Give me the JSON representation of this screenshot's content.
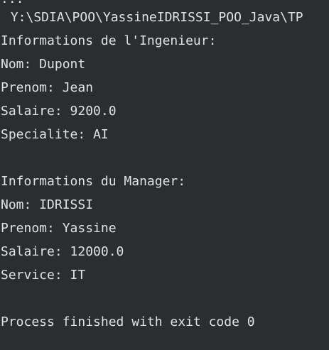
{
  "console": {
    "command_fragment": "...",
    "path_line": " Y:\\SDIA\\POO\\YassineIDRISSI_POO_Java\\TP",
    "lines": [
      "Informations de l'Ingenieur:",
      "Nom: Dupont",
      "Prenom: Jean",
      "Salaire: 9200.0",
      "Specialite: AI",
      "Informations du Manager:",
      "Nom: IDRISSI",
      "Prenom: Yassine",
      "Salaire: 12000.0",
      "Service: IT",
      "Process finished with exit code 0"
    ]
  }
}
